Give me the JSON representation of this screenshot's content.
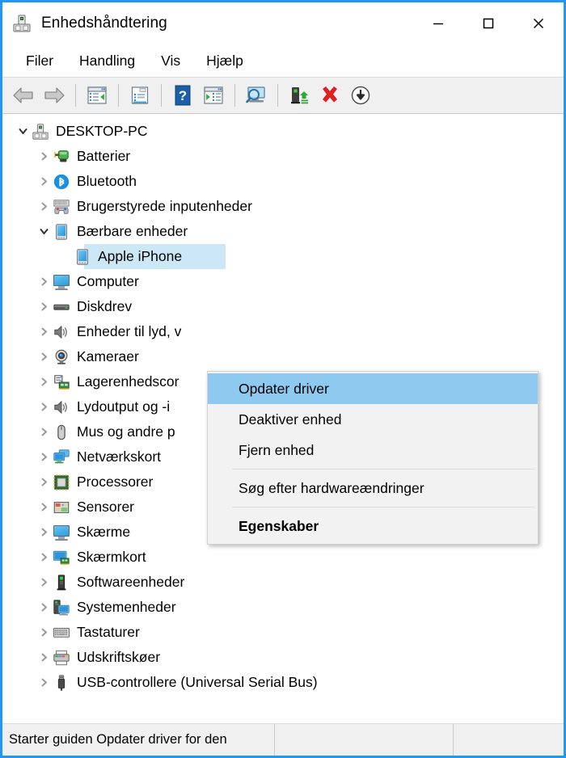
{
  "window": {
    "title": "Enhedshåndtering",
    "app_icon": "device-manager-icon",
    "border_color": "#2196f3",
    "minimize_label": "Minimer",
    "maximize_label": "Maksimer",
    "close_label": "Luk"
  },
  "menubar": {
    "items": [
      {
        "label": "Filer",
        "name": "menu-filer"
      },
      {
        "label": "Handling",
        "name": "menu-handling"
      },
      {
        "label": "Vis",
        "name": "menu-vis"
      },
      {
        "label": "Hjælp",
        "name": "menu-hjaelp"
      }
    ]
  },
  "toolbar": {
    "buttons": [
      {
        "icon": "back-arrow-icon",
        "tooltip": "Tilbage"
      },
      {
        "icon": "forward-arrow-icon",
        "tooltip": "Fremad"
      },
      {
        "icon": "show-hide-console-tree-icon",
        "tooltip": "Vis/skjul konsoltræ"
      },
      {
        "icon": "properties-icon",
        "tooltip": "Egenskaber"
      },
      {
        "icon": "help-icon",
        "tooltip": "Hjælp"
      },
      {
        "icon": "update-driver-icon",
        "tooltip": "Opdater driver"
      },
      {
        "icon": "scan-hardware-changes-icon",
        "tooltip": "Søg efter hardwareændringer"
      },
      {
        "icon": "enable-device-icon",
        "tooltip": "Aktivér enhed"
      },
      {
        "icon": "uninstall-device-icon",
        "tooltip": "Fjern enhed"
      },
      {
        "icon": "disable-device-icon",
        "tooltip": "Deaktiver enhed"
      }
    ]
  },
  "tree": {
    "root": {
      "label": "DESKTOP-PC",
      "icon": "computer-device-icon",
      "expanded": true
    },
    "items": [
      {
        "label": "Batterier",
        "icon": "battery-icon",
        "level": 1,
        "expanded": false,
        "selected": false
      },
      {
        "label": "Bluetooth",
        "icon": "bluetooth-icon",
        "level": 1,
        "expanded": false,
        "selected": false
      },
      {
        "label": "Brugerstyrede inputenheder",
        "icon": "hid-gamepad-icon",
        "level": 1,
        "expanded": false,
        "selected": false
      },
      {
        "label": "Bærbare enheder",
        "icon": "portable-device-icon",
        "level": 1,
        "expanded": true,
        "selected": false
      },
      {
        "label": "Apple iPhone",
        "icon": "iphone-icon",
        "level": 2,
        "expanded": null,
        "selected": true
      },
      {
        "label": "Computer",
        "icon": "monitor-icon",
        "level": 1,
        "expanded": false,
        "selected": false
      },
      {
        "label": "Diskdrev",
        "icon": "disk-drive-icon",
        "level": 1,
        "expanded": false,
        "selected": false
      },
      {
        "label": "Enheder til lyd, v",
        "icon": "speaker-icon",
        "level": 1,
        "expanded": false,
        "selected": false
      },
      {
        "label": "Kameraer",
        "icon": "camera-icon",
        "level": 1,
        "expanded": false,
        "selected": false
      },
      {
        "label": "Lagerenhedscor",
        "icon": "storage-controller-icon",
        "level": 1,
        "expanded": false,
        "selected": false
      },
      {
        "label": "Lydoutput og -i",
        "icon": "speaker-icon",
        "level": 1,
        "expanded": false,
        "selected": false
      },
      {
        "label": "Mus og andre p",
        "icon": "mouse-icon",
        "level": 1,
        "expanded": false,
        "selected": false
      },
      {
        "label": "Netværkskort",
        "icon": "network-adapter-icon",
        "level": 1,
        "expanded": false,
        "selected": false
      },
      {
        "label": "Processorer",
        "icon": "processor-icon",
        "level": 1,
        "expanded": false,
        "selected": false
      },
      {
        "label": "Sensorer",
        "icon": "sensor-icon",
        "level": 1,
        "expanded": false,
        "selected": false
      },
      {
        "label": "Skærme",
        "icon": "monitor-icon",
        "level": 1,
        "expanded": false,
        "selected": false
      },
      {
        "label": "Skærmkort",
        "icon": "display-adapter-icon",
        "level": 1,
        "expanded": false,
        "selected": false
      },
      {
        "label": "Softwareenheder",
        "icon": "software-device-icon",
        "level": 1,
        "expanded": false,
        "selected": false
      },
      {
        "label": "Systemenheder",
        "icon": "system-device-icon",
        "level": 1,
        "expanded": false,
        "selected": false
      },
      {
        "label": "Tastaturer",
        "icon": "keyboard-icon",
        "level": 1,
        "expanded": false,
        "selected": false
      },
      {
        "label": "Udskriftskøer",
        "icon": "printer-icon",
        "level": 1,
        "expanded": false,
        "selected": false
      },
      {
        "label": "USB-controllere (Universal Serial Bus)",
        "icon": "usb-icon",
        "level": 1,
        "expanded": false,
        "selected": false
      }
    ],
    "selection_color": "#cce8f7"
  },
  "context_menu": {
    "highlight_color": "#8ec9ef",
    "items": [
      {
        "label": "Opdater driver",
        "name": "ctx-opdater-driver",
        "highlighted": true,
        "bold": false,
        "separator_after": false
      },
      {
        "label": "Deaktiver enhed",
        "name": "ctx-deaktiver-enhed",
        "highlighted": false,
        "bold": false,
        "separator_after": false
      },
      {
        "label": "Fjern enhed",
        "name": "ctx-fjern-enhed",
        "highlighted": false,
        "bold": false,
        "separator_after": true
      },
      {
        "label": "Søg efter hardwareændringer",
        "name": "ctx-soeg-hardwareaendringer",
        "highlighted": false,
        "bold": false,
        "separator_after": true
      },
      {
        "label": "Egenskaber",
        "name": "ctx-egenskaber",
        "highlighted": false,
        "bold": true,
        "separator_after": false
      }
    ]
  },
  "statusbar": {
    "message": "Starter guiden Opdater driver for den",
    "segment2": "",
    "segment3": ""
  }
}
